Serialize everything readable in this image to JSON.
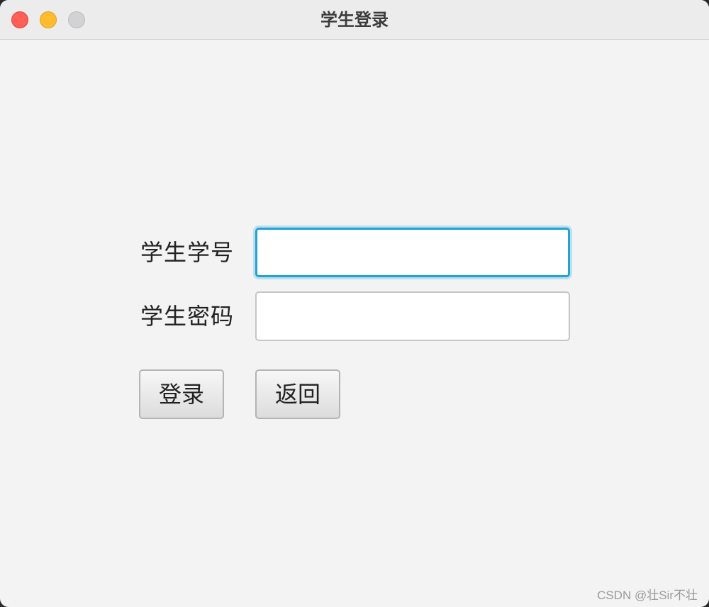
{
  "window": {
    "title": "学生登录"
  },
  "form": {
    "student_id_label": "学生学号",
    "student_id_value": "",
    "password_label": "学生密码",
    "password_value": ""
  },
  "buttons": {
    "login_label": "登录",
    "back_label": "返回"
  },
  "watermark": "CSDN @壮Sir不壮",
  "colors": {
    "close": "#fe5f57",
    "minimize": "#febc2e",
    "zoom": "#d2d2d4",
    "focus_ring": "#22a3d0"
  }
}
